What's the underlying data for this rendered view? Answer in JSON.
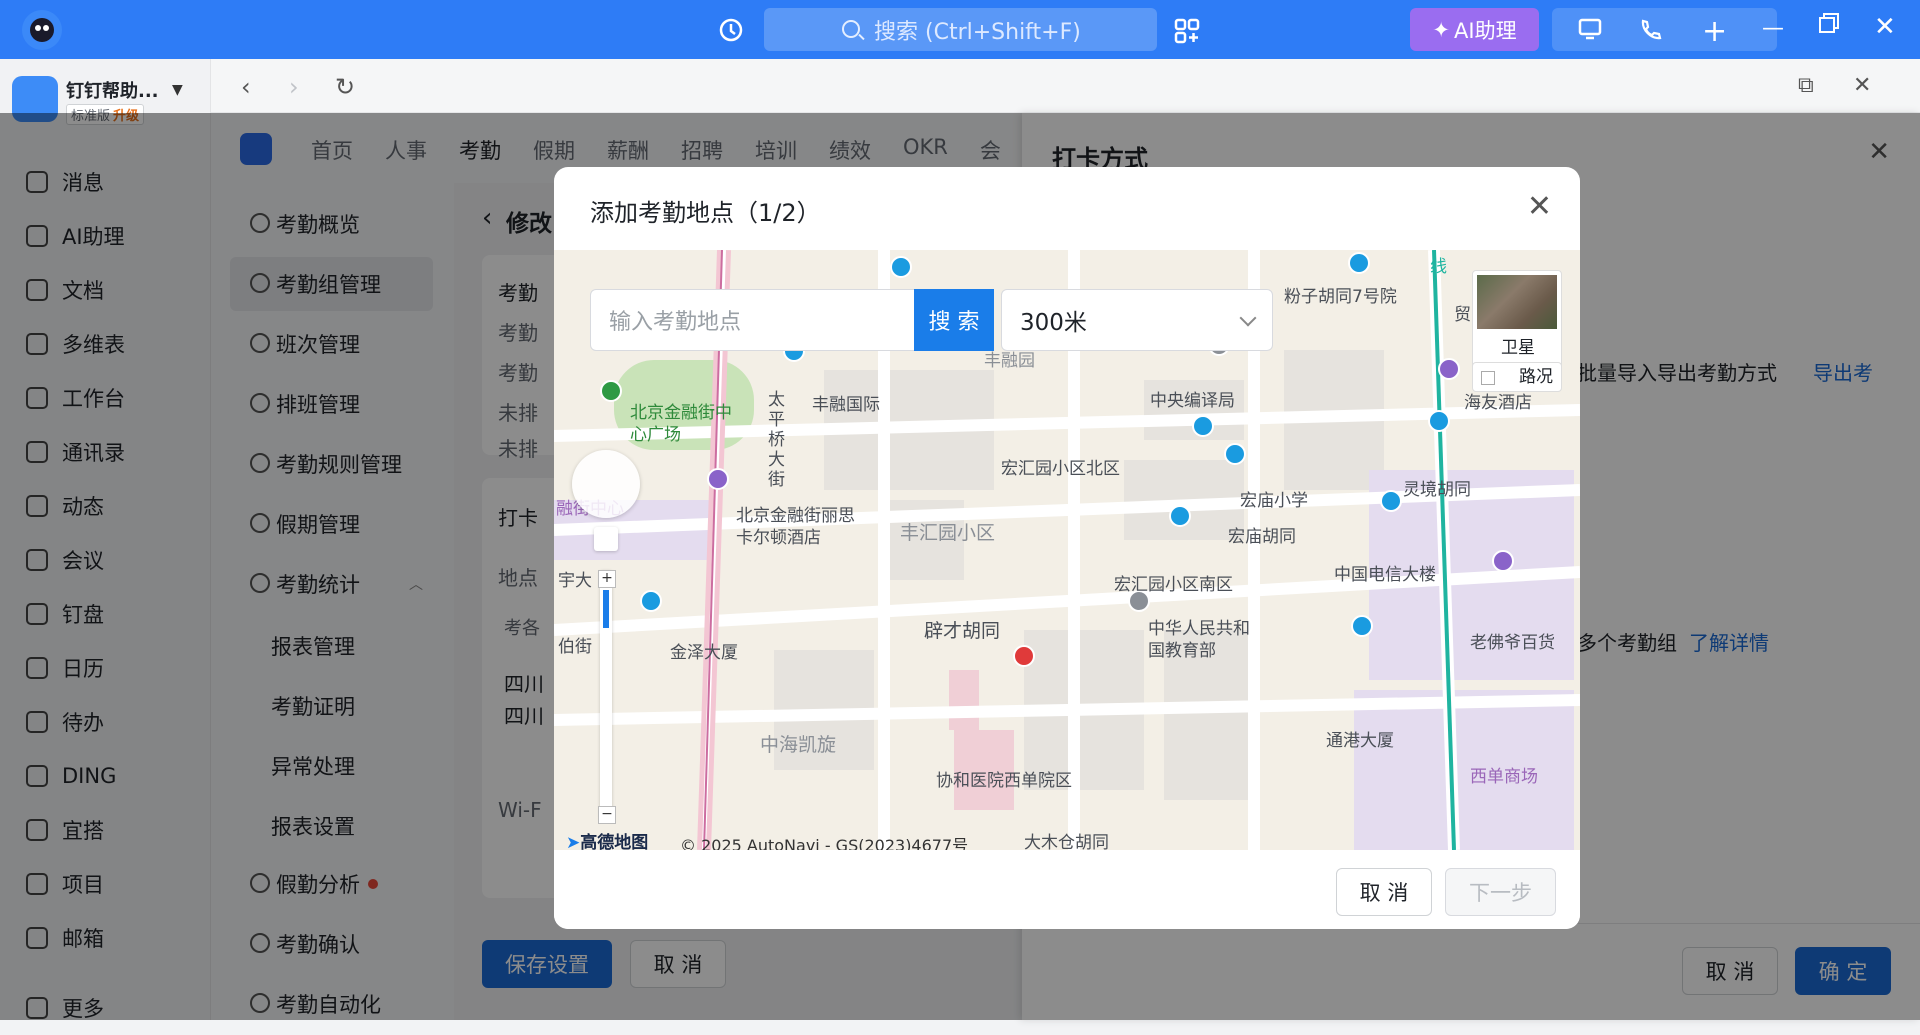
{
  "topbar": {
    "search_placeholder": "搜索 (Ctrl+Shift+F)",
    "ai_label": "AI助理",
    "accent": "#2e7cf6"
  },
  "org": {
    "name": "钉钉帮助...",
    "edition": "标准版",
    "upgrade": "升级"
  },
  "nav": [
    {
      "label": "消息",
      "icon": "message-icon"
    },
    {
      "label": "AI助理",
      "icon": "ai-icon"
    },
    {
      "label": "文档",
      "icon": "doc-icon"
    },
    {
      "label": "多维表",
      "icon": "table-icon"
    },
    {
      "label": "工作台",
      "icon": "workbench-icon"
    },
    {
      "label": "通讯录",
      "icon": "contacts-icon"
    },
    {
      "label": "动态",
      "icon": "feed-icon"
    },
    {
      "label": "会议",
      "icon": "meeting-icon"
    },
    {
      "label": "钉盘",
      "icon": "drive-icon"
    },
    {
      "label": "日历",
      "icon": "calendar-icon"
    },
    {
      "label": "待办",
      "icon": "todo-icon"
    },
    {
      "label": "DING",
      "icon": "ding-icon"
    },
    {
      "label": "宜搭",
      "icon": "yida-icon"
    },
    {
      "label": "项目",
      "icon": "project-icon"
    },
    {
      "label": "邮箱",
      "icon": "mail-icon"
    },
    {
      "label": "更多",
      "icon": "more-icon"
    }
  ],
  "apptabs": [
    "首页",
    "人事",
    "考勤",
    "假期",
    "薪酬",
    "招聘",
    "培训",
    "绩效",
    "OKR",
    "会"
  ],
  "leftmenu": {
    "items": [
      "考勤概览",
      "考勤组管理",
      "班次管理",
      "排班管理",
      "考勤规则管理",
      "假期管理",
      "考勤统计"
    ],
    "subitems": [
      "报表管理",
      "考勤证明",
      "异常处理",
      "报表设置"
    ],
    "bottom": [
      "假勤分析",
      "考勤确认",
      "考勤自动化"
    ]
  },
  "content": {
    "back_title": "修改",
    "rows": [
      "考勤",
      "考勤",
      "考勤",
      "未排",
      "未排"
    ],
    "punch": "打卡",
    "place": "地点",
    "col": "考各",
    "addr1": "四川",
    "addr2": "四川",
    "wifi": "Wi-F",
    "save": "保存设置",
    "cancel": "取 消"
  },
  "drawer": {
    "title": "打卡方式",
    "import_text": "批量导入导出考勤方式",
    "export_link": "导出考",
    "multi_text": "多个考勤组",
    "detail_link": "了解详情",
    "cancel": "取 消",
    "confirm": "确 定"
  },
  "modal": {
    "title": "添加考勤地点（1/2）",
    "search_placeholder": "输入考勤地点",
    "search_btn": "搜 索",
    "radius": "300米",
    "satellite": "卫星",
    "traffic": "路况",
    "copyright": "© 2025 AutoNavi - GS(2023)4677号",
    "brand": "高德地图",
    "cancel": "取 消",
    "next": "下一步"
  },
  "map_labels": [
    "粉子胡同7号院",
    "丰融园",
    "丰融国际",
    "中央编译局",
    "海友酒店",
    "北京金融街中心广场",
    "宏汇园小区北区",
    "灵境胡同",
    "宏庙小学",
    "宏庙胡同",
    "北京金融街丽思卡尔顿酒店",
    "丰汇园小区",
    "中国电信大楼",
    "宏汇园小区南区",
    "辟才胡同",
    "老佛爷百货",
    "金泽大厦",
    "中华人民共和国教育部",
    "通港大厦",
    "中海凯旋",
    "协和医院西单院区",
    "西单商场",
    "大木仓胡同",
    "太平桥大街",
    "宇大",
    "伯街",
    "融街中心",
    "线",
    "贸"
  ]
}
